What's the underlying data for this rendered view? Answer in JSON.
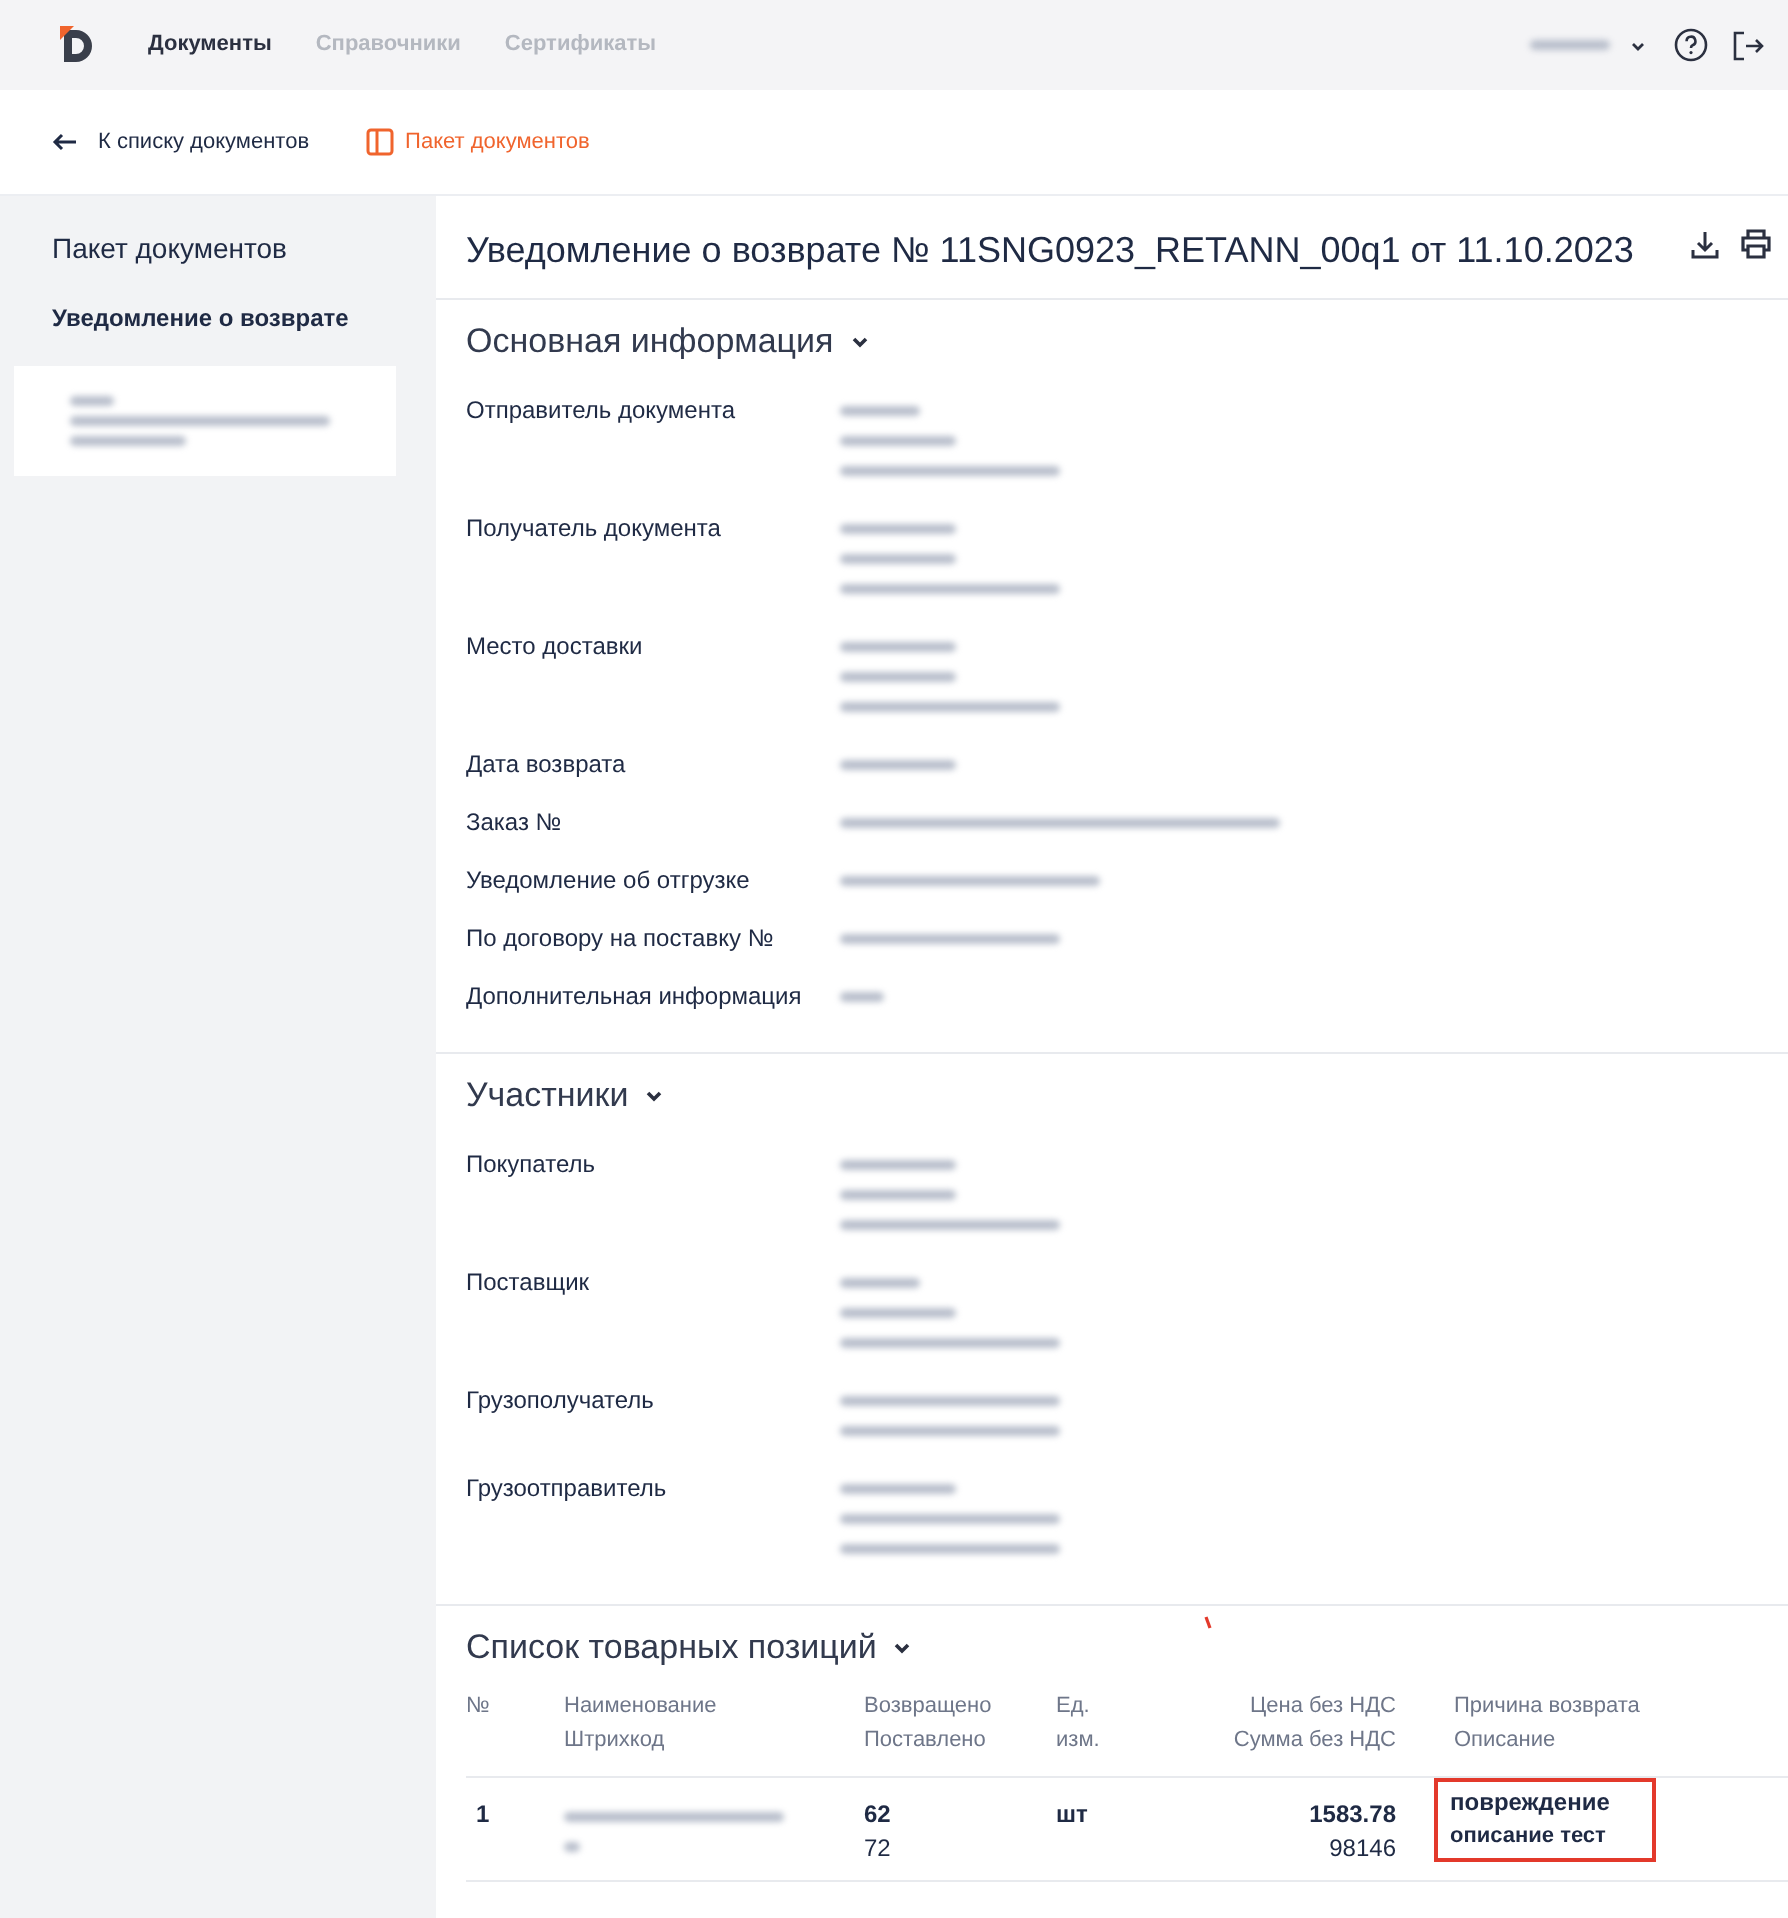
{
  "topbar": {
    "nav": [
      {
        "label": "Документы",
        "selected": true
      },
      {
        "label": "Справочники",
        "selected": false
      },
      {
        "label": "Сертификаты",
        "selected": false
      }
    ],
    "user": {
      "value_lines": [
        {
          "kind": "short"
        }
      ]
    }
  },
  "toolbar": {
    "back_link": "К списку документов",
    "package_button": "Пакет документов"
  },
  "sidebar": {
    "title": "Пакет документов",
    "group": "Уведомление о возврате",
    "items": [
      {
        "selected": true,
        "value_lines": [
          {
            "kind": "tiny"
          },
          {
            "kind": "wide"
          },
          {
            "kind": "medium"
          }
        ]
      }
    ]
  },
  "document": {
    "title": "Уведомление о возврате № 11SNG0923_RETANN_00q1 от 11.10.2023",
    "sections": [
      {
        "title": "Основная информация",
        "expanded": true,
        "fields": [
          {
            "label": "Отправитель документа",
            "value_lines": [
              {
                "kind": "short"
              },
              {
                "kind": "medium"
              },
              {
                "kind": "long"
              }
            ]
          },
          {
            "label": "Получатель документа",
            "value_lines": [
              {
                "kind": "medium"
              },
              {
                "kind": "medium"
              },
              {
                "kind": "long"
              }
            ]
          },
          {
            "label": "Место доставки",
            "value_lines": [
              {
                "kind": "medium"
              },
              {
                "kind": "medium"
              },
              {
                "kind": "long"
              }
            ]
          },
          {
            "label": "Дата возврата",
            "value_lines": [
              {
                "kind": "medium"
              }
            ]
          },
          {
            "label": "Заказ №",
            "value_lines": [
              {
                "kind": "full"
              }
            ]
          },
          {
            "label": "Уведомление об отгрузке",
            "value_lines": [
              {
                "kind": "wide"
              }
            ]
          },
          {
            "label": "По договору на поставку №",
            "value_lines": [
              {
                "kind": "long"
              }
            ]
          },
          {
            "label": "Дополнительная информация",
            "value_lines": [
              {
                "kind": "tiny"
              }
            ]
          }
        ]
      },
      {
        "title": "Участники",
        "expanded": true,
        "fields": [
          {
            "label": "Покупатель",
            "value_lines": [
              {
                "kind": "medium"
              },
              {
                "kind": "medium"
              },
              {
                "kind": "long"
              }
            ]
          },
          {
            "label": "Поставщик",
            "value_lines": [
              {
                "kind": "short"
              },
              {
                "kind": "medium"
              },
              {
                "kind": "long"
              }
            ]
          },
          {
            "label": "Грузополучатель",
            "value_lines": [
              {
                "kind": "long"
              },
              {
                "kind": "long"
              }
            ]
          },
          {
            "label": "Грузоотправитель",
            "value_lines": [
              {
                "kind": "medium"
              },
              {
                "kind": "long"
              },
              {
                "kind": "long"
              }
            ]
          }
        ]
      }
    ],
    "items": {
      "title": "Список товарных позиций",
      "expanded": true,
      "columns": [
        {
          "lines": [
            "№"
          ],
          "kind": "text"
        },
        {
          "lines": [
            "Наименование",
            "Штрихкод"
          ],
          "kind": "text"
        },
        {
          "lines": [
            "Возвращено",
            "Поставлено"
          ],
          "kind": "text"
        },
        {
          "lines": [
            "Ед.",
            "изм."
          ],
          "kind": "text"
        },
        {
          "lines": [
            "Цена без НДС",
            "Сумма без НДС"
          ],
          "kind": "amount"
        },
        {
          "lines": [
            "Причина возврата",
            "Описание"
          ],
          "kind": "text"
        }
      ],
      "rows": [
        {
          "number": "1",
          "name_lines": [
            {
              "kind": "long"
            },
            {
              "kind": "dot"
            }
          ],
          "returned": "62",
          "delivered": "72",
          "unit": "шт",
          "price": "1583.78",
          "sum": "98146",
          "reason": "повреждение",
          "description": "описание тест",
          "highlighted": true
        }
      ]
    }
  }
}
